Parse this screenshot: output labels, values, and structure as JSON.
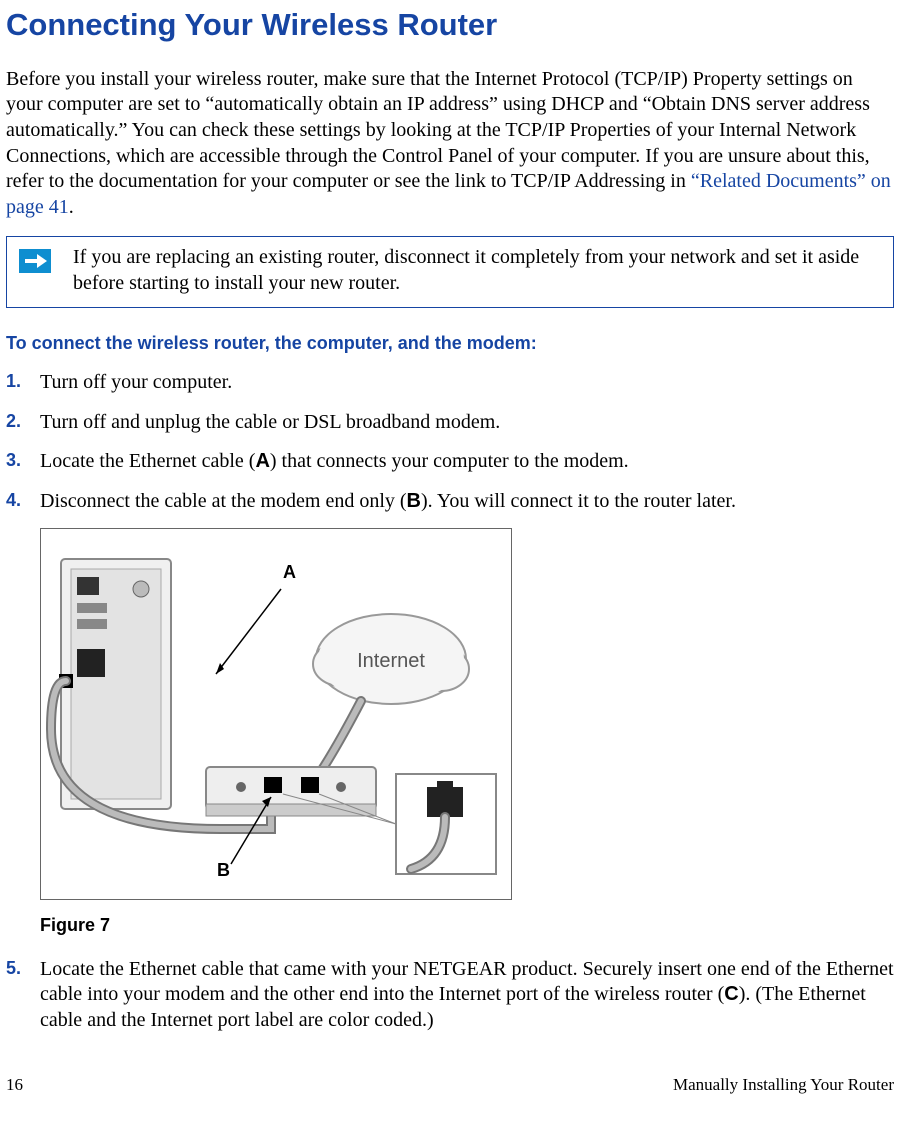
{
  "title": "Connecting Your Wireless Router",
  "intro_pre": "Before you install your wireless router, make sure that the Internet Protocol (TCP/IP) Property settings on your computer are set to “automatically obtain an IP address” using DHCP and “Obtain DNS server address automatically.” You can check these settings by looking at the TCP/IP Properties of your Internal Network Connections, which are accessible through the Control Panel of your computer. If you are unsure about this, refer to the documentation for your computer or see the link to TCP/IP Addressing in  ",
  "intro_link": "“Related Documents” on page 41",
  "intro_post": ".",
  "note": "If you are replacing an existing router, disconnect it completely from your network and set it aside before starting to install your new router.",
  "subheading": "To connect the wireless router, the computer, and the modem:",
  "steps": {
    "s1": "Turn off your computer.",
    "s2": "Turn off and unplug the cable or DSL broadband modem.",
    "s3a": "Locate the Ethernet cable (",
    "s3b": "A",
    "s3c": ") that connects your computer to the modem.",
    "s4a": "Disconnect the cable at the modem end only (",
    "s4b": "B",
    "s4c": "). You will connect it to the router later.",
    "s5a": "Locate the Ethernet cable that came with your NETGEAR product. Securely insert one end of the Ethernet cable into your modem and the other end into the Internet port of the wireless router (",
    "s5b": "C",
    "s5c": "). (The Ethernet cable and the Internet port label are color coded.)"
  },
  "figure": {
    "labelA": "A",
    "labelB": "B",
    "internet": "Internet",
    "caption": "Figure 7"
  },
  "footer": {
    "page": "16",
    "section": "Manually Installing Your Router"
  }
}
